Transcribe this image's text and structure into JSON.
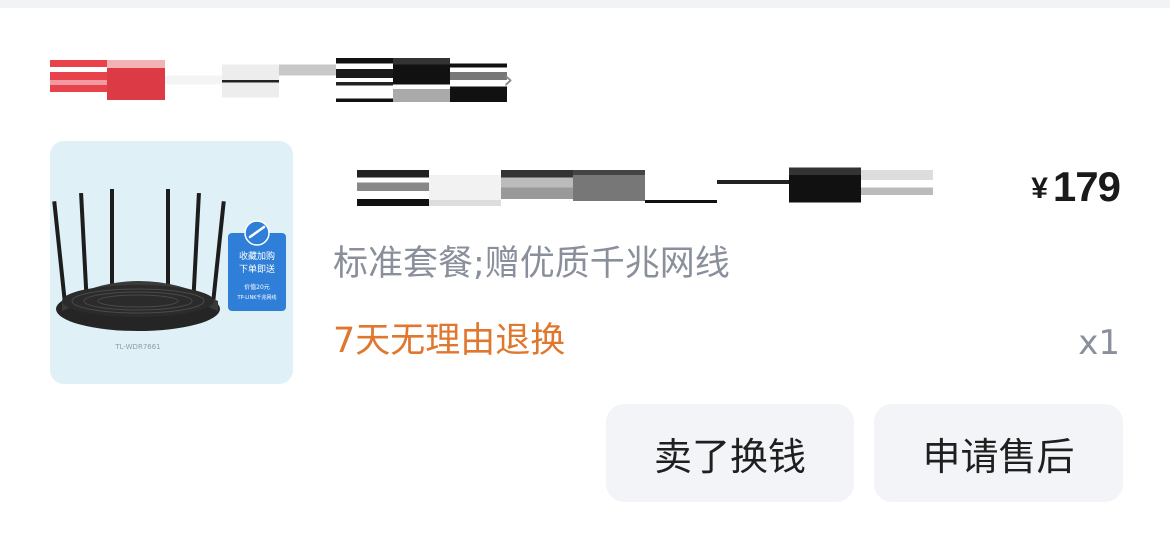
{
  "order": {
    "product": {
      "image_label": "TL-WDR7661",
      "price_currency": "¥",
      "price_value": "179",
      "variant": "标准套餐;赠优质千兆网线",
      "return_policy": "7天无理由退换",
      "quantity": "x1",
      "promo_badge": {
        "line1": "收藏加购",
        "line2": "下单即送",
        "line3": "价值20元",
        "line4": "TP-LINK千兆网线"
      }
    },
    "actions": {
      "sell_label": "卖了换钱",
      "after_sale_label": "申请售后"
    }
  },
  "colors": {
    "accent_orange": "#e0772e",
    "muted_text": "#8a8f9c",
    "button_bg": "#f2f4f7",
    "image_bg": "#dff1f7",
    "badge_blue": "#2f7fd8"
  }
}
